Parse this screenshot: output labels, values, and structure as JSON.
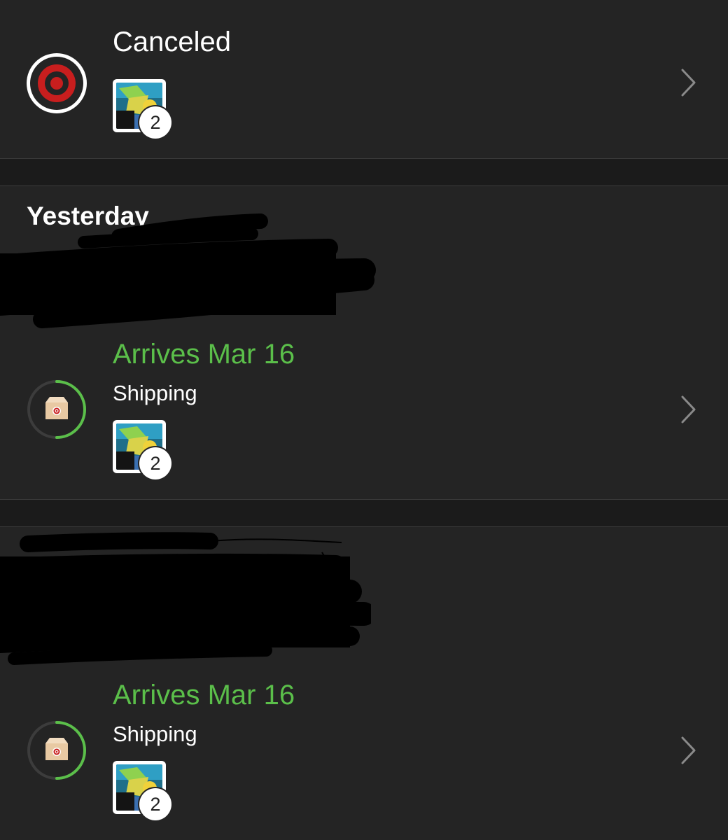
{
  "orders": [
    {
      "status": "Canceled",
      "status_icon": "target-logo-icon",
      "item_quantity": "2",
      "colors": {
        "status_icon": "#cc1f1f"
      }
    },
    {
      "arrival": "Arrives Mar 16",
      "status": "Shipping",
      "status_icon": "package-icon",
      "progress": 0.5,
      "item_quantity": "2"
    },
    {
      "arrival": "Arrives Mar 16",
      "status": "Shipping",
      "status_icon": "package-icon",
      "progress": 0.5,
      "item_quantity": "2"
    }
  ],
  "sections": {
    "yesterday_heading": "Yesterday"
  },
  "colors": {
    "background": "#1b1b1b",
    "card": "#242424",
    "arrival_text": "#5bbf4a",
    "progress_ring": "#5bbf4a",
    "progress_track": "#3c3c3c"
  }
}
